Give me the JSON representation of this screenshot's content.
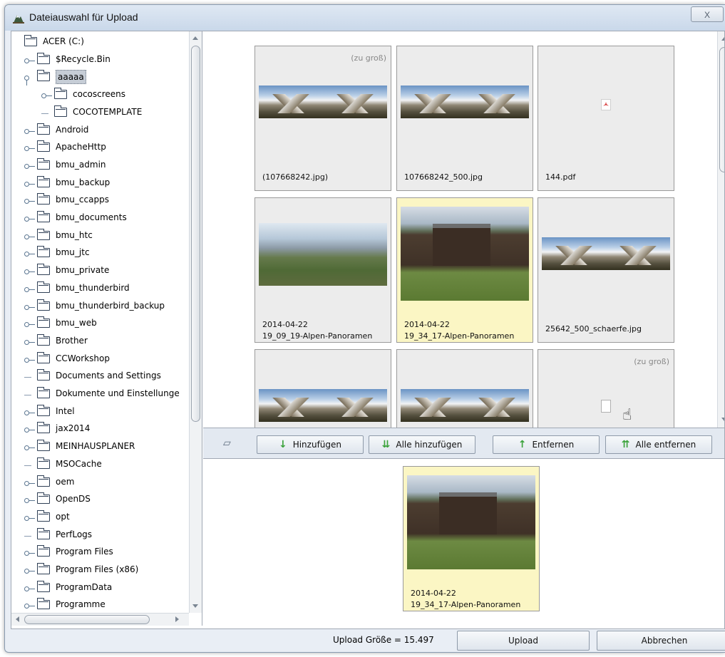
{
  "window": {
    "title": "Dateiauswahl für Upload",
    "close_glyph": "X"
  },
  "tree": {
    "items": [
      {
        "label": "ACER (C:)",
        "level": 0,
        "toggle": "none",
        "selected": false
      },
      {
        "label": "$Recycle.Bin",
        "level": 1,
        "toggle": "closed",
        "selected": false
      },
      {
        "label": "aaaaa",
        "level": 1,
        "toggle": "open",
        "selected": true
      },
      {
        "label": "cocoscreens",
        "level": 2,
        "toggle": "closed",
        "selected": false
      },
      {
        "label": "COCOTEMPLATE",
        "level": 2,
        "toggle": "none",
        "selected": false
      },
      {
        "label": "Android",
        "level": 1,
        "toggle": "closed",
        "selected": false
      },
      {
        "label": "ApacheHttp",
        "level": 1,
        "toggle": "closed",
        "selected": false
      },
      {
        "label": "bmu_admin",
        "level": 1,
        "toggle": "closed",
        "selected": false
      },
      {
        "label": "bmu_backup",
        "level": 1,
        "toggle": "closed",
        "selected": false
      },
      {
        "label": "bmu_ccapps",
        "level": 1,
        "toggle": "closed",
        "selected": false
      },
      {
        "label": "bmu_documents",
        "level": 1,
        "toggle": "closed",
        "selected": false
      },
      {
        "label": "bmu_htc",
        "level": 1,
        "toggle": "closed",
        "selected": false
      },
      {
        "label": "bmu_jtc",
        "level": 1,
        "toggle": "closed",
        "selected": false
      },
      {
        "label": "bmu_private",
        "level": 1,
        "toggle": "closed",
        "selected": false
      },
      {
        "label": "bmu_thunderbird",
        "level": 1,
        "toggle": "closed",
        "selected": false
      },
      {
        "label": "bmu_thunderbird_backup",
        "level": 1,
        "toggle": "closed",
        "selected": false
      },
      {
        "label": "bmu_web",
        "level": 1,
        "toggle": "closed",
        "selected": false
      },
      {
        "label": "Brother",
        "level": 1,
        "toggle": "closed",
        "selected": false
      },
      {
        "label": "CCWorkshop",
        "level": 1,
        "toggle": "closed",
        "selected": false
      },
      {
        "label": "Documents and Settings",
        "level": 1,
        "toggle": "none",
        "selected": false
      },
      {
        "label": "Dokumente und Einstellunge",
        "level": 1,
        "toggle": "none",
        "selected": false
      },
      {
        "label": "Intel",
        "level": 1,
        "toggle": "closed",
        "selected": false
      },
      {
        "label": "jax2014",
        "level": 1,
        "toggle": "closed",
        "selected": false
      },
      {
        "label": "MEINHAUSPLANER",
        "level": 1,
        "toggle": "closed",
        "selected": false
      },
      {
        "label": "MSOCache",
        "level": 1,
        "toggle": "none",
        "selected": false
      },
      {
        "label": "oem",
        "level": 1,
        "toggle": "closed",
        "selected": false
      },
      {
        "label": "OpenDS",
        "level": 1,
        "toggle": "closed",
        "selected": false
      },
      {
        "label": "opt",
        "level": 1,
        "toggle": "closed",
        "selected": false
      },
      {
        "label": "PerfLogs",
        "level": 1,
        "toggle": "none",
        "selected": false
      },
      {
        "label": "Program Files",
        "level": 1,
        "toggle": "closed",
        "selected": false
      },
      {
        "label": "Program Files (x86)",
        "level": 1,
        "toggle": "closed",
        "selected": false
      },
      {
        "label": "ProgramData",
        "level": 1,
        "toggle": "closed",
        "selected": false
      },
      {
        "label": "Programme",
        "level": 1,
        "toggle": "closed",
        "selected": false
      }
    ]
  },
  "grid": {
    "too_large": "(zu groß)",
    "cards": [
      {
        "line1": "(107668242.jpg)",
        "line2": "",
        "kind": "pano",
        "too_large": true,
        "selected": false
      },
      {
        "line1": "107668242_500.jpg",
        "line2": "",
        "kind": "pano",
        "too_large": false,
        "selected": false
      },
      {
        "line1": "144.pdf",
        "line2": "",
        "kind": "pdf",
        "too_large": false,
        "selected": false
      },
      {
        "line1": "2014-04-22",
        "line2": "19_09_19-Alpen-Panoramen",
        "kind": "valley",
        "too_large": false,
        "selected": false
      },
      {
        "line1": "2014-04-22",
        "line2": "19_34_17-Alpen-Panoramen",
        "kind": "chalet",
        "too_large": false,
        "selected": true
      },
      {
        "line1": "25642_500_schaerfe.jpg",
        "line2": "",
        "kind": "pano",
        "too_large": false,
        "selected": false
      },
      {
        "line1": "",
        "line2": "",
        "kind": "pano",
        "too_large": false,
        "selected": false
      },
      {
        "line1": "",
        "line2": "",
        "kind": "pano",
        "too_large": false,
        "selected": false
      },
      {
        "line1": "",
        "line2": "",
        "kind": "file",
        "too_large": true,
        "selected": false
      }
    ]
  },
  "toolbar": {
    "add": "Hinzufügen",
    "add_all": "Alle hinzufügen",
    "remove": "Entfernen",
    "remove_all": "Alle entfernen"
  },
  "selection": {
    "cards": [
      {
        "line1": "2014-04-22",
        "line2": "19_34_17-Alpen-Panoramen",
        "kind": "chalet"
      }
    ]
  },
  "bottom": {
    "upload_size": "Upload Größe = 15.497",
    "upload": "Upload",
    "cancel": "Abbrechen"
  },
  "colors": {
    "selection_bg": "#fbf6c4",
    "card_bg": "#ececec",
    "accent_green": "#3aa23a"
  }
}
